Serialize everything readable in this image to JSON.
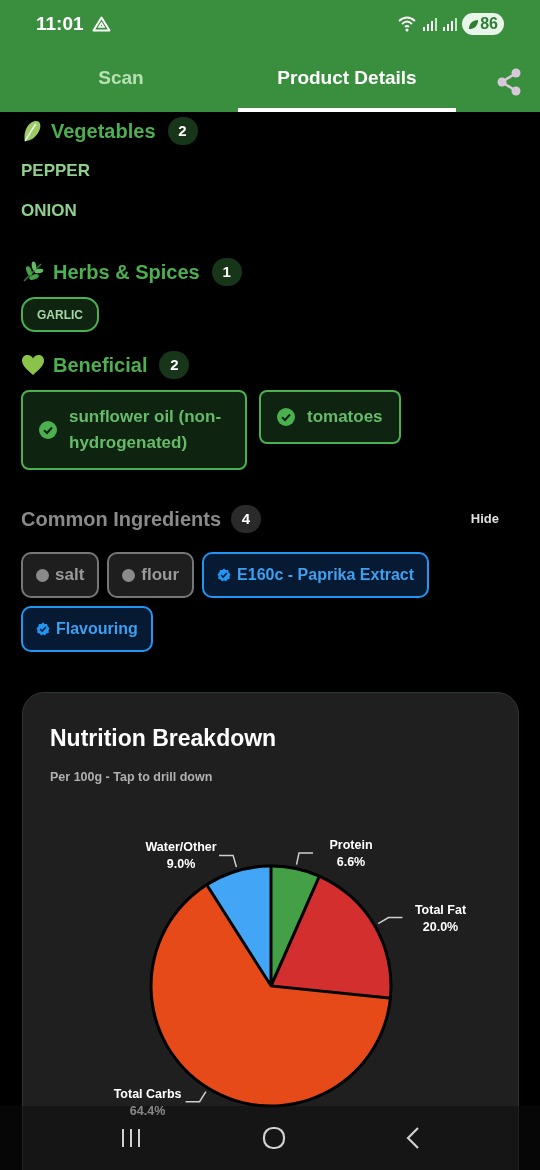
{
  "status_bar": {
    "time": "11:01",
    "battery": "86"
  },
  "tabs": [
    {
      "label": "Scan",
      "selected": false
    },
    {
      "label": "Product Details",
      "selected": true
    }
  ],
  "sections": [
    {
      "kind": "list",
      "title": "Vegetables",
      "count": "2",
      "items": [
        "PEPPER",
        "ONION"
      ]
    },
    {
      "kind": "outline-chips",
      "title": "Herbs & Spices",
      "count": "1",
      "items": [
        "GARLIC"
      ]
    },
    {
      "kind": "check-chips",
      "title": "Beneficial",
      "count": "2",
      "items": [
        "sunflower oil (non-hydrogenated)",
        "tomatoes"
      ]
    }
  ],
  "common": {
    "title": "Common Ingredients",
    "count": "4",
    "toggle": "Hide",
    "items": [
      {
        "label": "salt",
        "kind": "plain"
      },
      {
        "label": "flour",
        "kind": "plain"
      },
      {
        "label": "E160c - Paprika Extract",
        "kind": "verified"
      },
      {
        "label": "Flavouring",
        "kind": "verified"
      }
    ]
  },
  "nutrition": {
    "title": "Nutrition Breakdown",
    "subtitle": "Per 100g - Tap to drill down",
    "chart_data": {
      "type": "pie",
      "categories": [
        "Protein",
        "Total Fat",
        "Total Carbs",
        "Water/Other"
      ],
      "values": [
        6.6,
        20.0,
        64.4,
        9.0
      ],
      "colors": [
        "#43a047",
        "#d32f2f",
        "#e64a19",
        "#42a5f5"
      ],
      "data_labels": true,
      "value_labels": [
        "6.6%",
        "20.0%",
        "64.4%",
        "9.0%"
      ]
    }
  }
}
